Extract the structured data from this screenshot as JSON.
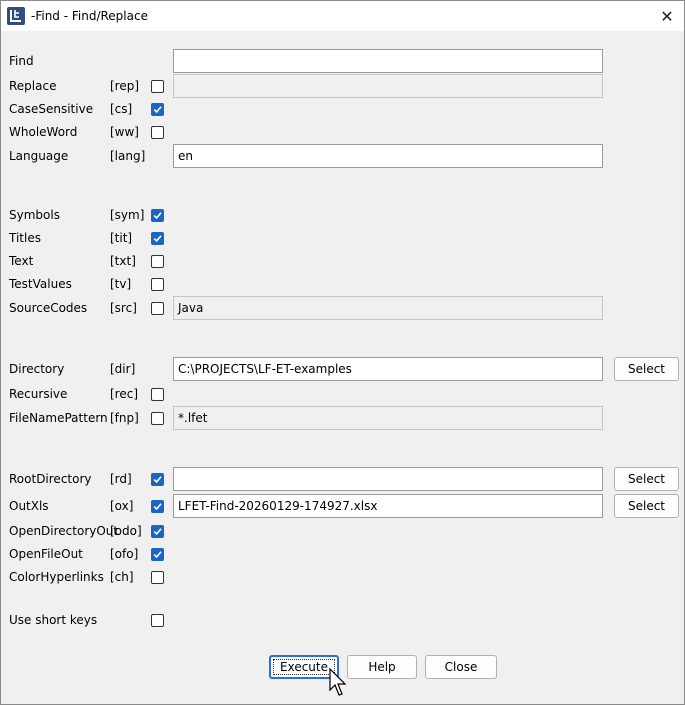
{
  "window": {
    "title": "-Find - Find/Replace",
    "icon": "lf-logo-icon",
    "close_glyph": "✕"
  },
  "fields": [
    {
      "id": "find",
      "label": "Find",
      "key": "",
      "checkbox": null,
      "input": {
        "value": "",
        "enabled": true
      }
    },
    {
      "id": "replace",
      "label": "Replace",
      "key": "[rep]",
      "checkbox": false,
      "input": {
        "value": "",
        "enabled": false
      }
    },
    {
      "id": "cs",
      "label": "CaseSensitive",
      "key": "[cs]",
      "checkbox": true,
      "input": null
    },
    {
      "id": "ww",
      "label": "WholeWord",
      "key": "[ww]",
      "checkbox": false,
      "input": null
    },
    {
      "id": "lang",
      "label": "Language",
      "key": "[lang]",
      "checkbox": null,
      "input": {
        "value": "en",
        "enabled": true
      }
    },
    {
      "id": "sym",
      "label": "Symbols",
      "key": "[sym]",
      "checkbox": true,
      "input": null
    },
    {
      "id": "tit",
      "label": "Titles",
      "key": "[tit]",
      "checkbox": true,
      "input": null
    },
    {
      "id": "txt",
      "label": "Text",
      "key": "[txt]",
      "checkbox": false,
      "input": null
    },
    {
      "id": "tv",
      "label": "TestValues",
      "key": "[tv]",
      "checkbox": false,
      "input": null
    },
    {
      "id": "src",
      "label": "SourceCodes",
      "key": "[src]",
      "checkbox": false,
      "input": {
        "value": "Java",
        "enabled": false
      }
    },
    {
      "id": "dir",
      "label": "Directory",
      "key": "[dir]",
      "checkbox": null,
      "input": {
        "value": "C:\\PROJECTS\\LF-ET-examples",
        "enabled": true
      },
      "button": "Select"
    },
    {
      "id": "rec",
      "label": "Recursive",
      "key": "[rec]",
      "checkbox": false,
      "input": null
    },
    {
      "id": "fnp",
      "label": "FileNamePattern",
      "key": "[fnp]",
      "checkbox": false,
      "input": {
        "value": "*.lfet",
        "enabled": false
      }
    },
    {
      "id": "rd",
      "label": "RootDirectory",
      "key": "[rd]",
      "checkbox": true,
      "input": {
        "value": "",
        "enabled": true
      },
      "button": "Select"
    },
    {
      "id": "ox",
      "label": "OutXls",
      "key": "[ox]",
      "checkbox": true,
      "input": {
        "value": "LFET-Find-20260129-174927.xlsx",
        "enabled": true
      },
      "button": "Select"
    },
    {
      "id": "odo",
      "label": "OpenDirectoryOut",
      "key": "[odo]",
      "checkbox": true,
      "input": null
    },
    {
      "id": "ofo",
      "label": "OpenFileOut",
      "key": "[ofo]",
      "checkbox": true,
      "input": null
    },
    {
      "id": "ch",
      "label": "ColorHyperlinks",
      "key": "[ch]",
      "checkbox": false,
      "input": null
    },
    {
      "id": "short",
      "label": "Use short keys",
      "key": "",
      "checkbox": false,
      "input": null
    }
  ],
  "buttons": {
    "execute": "Execute",
    "help": "Help",
    "close": "Close"
  },
  "colors": {
    "accent": "#1a66c2",
    "dialog_bg": "#f0f0f0"
  }
}
